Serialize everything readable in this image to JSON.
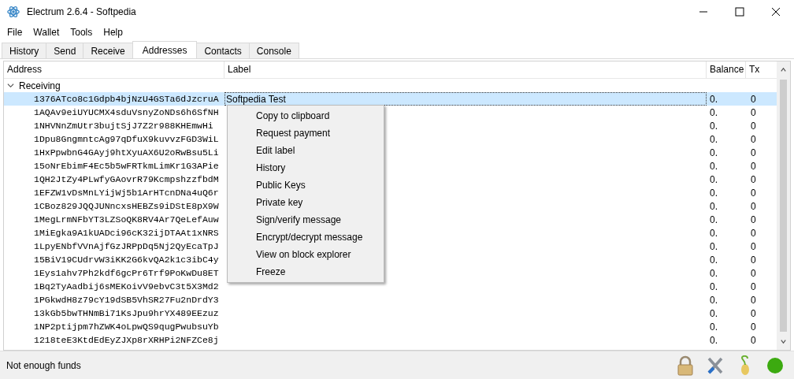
{
  "window": {
    "title": "Electrum 2.6.4  -  Softpedia"
  },
  "menu": [
    "File",
    "Wallet",
    "Tools",
    "Help"
  ],
  "tabs": [
    {
      "label": "History",
      "selected": false
    },
    {
      "label": "Send",
      "selected": false
    },
    {
      "label": "Receive",
      "selected": false
    },
    {
      "label": "Addresses",
      "selected": true
    },
    {
      "label": "Contacts",
      "selected": false
    },
    {
      "label": "Console",
      "selected": false
    }
  ],
  "table": {
    "columns": [
      "Address",
      "Label",
      "Balance",
      "Tx"
    ],
    "group": {
      "label": "Receiving",
      "expanded": true
    },
    "rows": [
      {
        "address": "1376ATco8c1Gdpb4bjNzU4GSTa6dJzcruA",
        "label": "Softpedia Test",
        "balance": "0.",
        "tx": "0",
        "selected": true
      },
      {
        "address": "1AQAv9eiUYUCMX4sduVsnyZoNDs6h6SfNH",
        "balance": "0.",
        "tx": "0",
        "selected": false
      },
      {
        "address": "1NHVNnZmUtr3bujtSjJ7Z2r988KHEmwHi",
        "balance": "0.",
        "tx": "0",
        "selected": false
      },
      {
        "address": "1Dpu8GngmntcAg97qDfuX9kuvvzFGD3WiL",
        "balance": "0.",
        "tx": "0",
        "selected": false
      },
      {
        "address": "1HxPpwbnG4GAyj9htXyuAX6U2oRwBsu5Li",
        "balance": "0.",
        "tx": "0",
        "selected": false
      },
      {
        "address": "15oNrEbimF4Ec5b5wFRTkmLimKr1G3APie",
        "balance": "0.",
        "tx": "0",
        "selected": false
      },
      {
        "address": "1QH2JtZy4PLwfyGAovrR79KcmpshzzfbdM",
        "balance": "0.",
        "tx": "0",
        "selected": false
      },
      {
        "address": "1EFZW1vDsMnLYijWj5b1ArHTcnDNa4uQ6r",
        "balance": "0.",
        "tx": "0",
        "selected": false
      },
      {
        "address": "1CBoz829JQQJUNncxsHEBZs9iDStE8pX9W",
        "balance": "0.",
        "tx": "0",
        "selected": false
      },
      {
        "address": "1MegLrmNFbYT3LZSoQK8RV4Ar7QeLefAuw",
        "balance": "0.",
        "tx": "0",
        "selected": false
      },
      {
        "address": "1MiEgka9A1kUADci96cK32ijDTAAt1xNRS",
        "balance": "0.",
        "tx": "0",
        "selected": false
      },
      {
        "address": "1LpyENbfVVnAjfGzJRPpDq5Nj2QyEcaTpJ",
        "balance": "0.",
        "tx": "0",
        "selected": false
      },
      {
        "address": "15BiV19CUdrvW3iKK2G6kvQA2k1c3ibC4y",
        "balance": "0.",
        "tx": "0",
        "selected": false
      },
      {
        "address": "1Eys1ahv7Ph2kdf6gcPr6Trf9PoKwDu8ET",
        "balance": "0.",
        "tx": "0",
        "selected": false
      },
      {
        "address": "1Bq2TyAadbij6sMEKoivV9ebvC3t5X3Md2",
        "balance": "0.",
        "tx": "0",
        "selected": false
      },
      {
        "address": "1PGkwdH8z79cY19dSB5VhSR27Fu2nDrdY3",
        "balance": "0.",
        "tx": "0",
        "selected": false
      },
      {
        "address": "13kGb5bwTHNmBi71KsJpu9hrYX489EEzuz",
        "balance": "0.",
        "tx": "0",
        "selected": false
      },
      {
        "address": "1NP2ptijpm7hZWK4oLpwQS9qugPwubsuYb",
        "balance": "0.",
        "tx": "0",
        "selected": false
      },
      {
        "address": "1218teE3KtdEdEyZJXp8rXRHPi2NFZCe8j",
        "balance": "0.",
        "tx": "0",
        "selected": false
      }
    ]
  },
  "context_menu": [
    "Copy to clipboard",
    "Request payment",
    "Edit label",
    "History",
    "Public Keys",
    "Private key",
    "Sign/verify message",
    "Encrypt/decrypt message",
    "View on block explorer",
    "Freeze"
  ],
  "status_bar": {
    "message": "Not enough funds"
  }
}
